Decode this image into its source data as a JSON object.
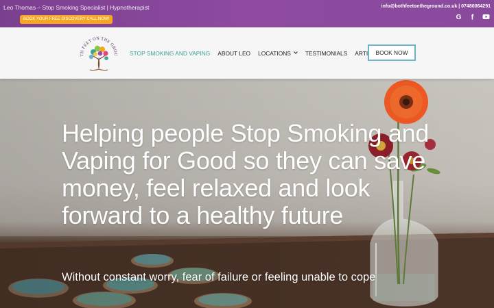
{
  "topbar": {
    "tagline": "Leo Thomas – Stop Smoking Specialist | Hypnotherapist",
    "cta_label": "BOOK YOUR FREE DISCOVERY CALL NOW!",
    "contact": "info@bothfeetontheground.co.uk | 07480064291",
    "social": [
      {
        "icon": "google-icon",
        "glyph": "G"
      },
      {
        "icon": "facebook-icon",
        "glyph": "f"
      },
      {
        "icon": "youtube-icon",
        "glyph": "▶"
      }
    ]
  },
  "logo": {
    "text": "BOTH FEET ON THE GROUND",
    "icon": "tree-logo-icon"
  },
  "nav": {
    "items": [
      {
        "label": "STOP SMOKING AND VAPING",
        "active": true
      },
      {
        "label": "ABOUT LEO",
        "active": false
      },
      {
        "label": "LOCATIONS",
        "active": false,
        "dropdown": true
      },
      {
        "label": "TESTIMONIALS",
        "active": false
      },
      {
        "label": "ARTICLES",
        "active": false
      }
    ],
    "dropdown_icon": "chevron-down-icon",
    "book_label": "BOOK NOW"
  },
  "hero": {
    "heading": "Helping people Stop Smoking and Vaping for Good so they can save money, feel relaxed and look forward to a healthy future",
    "subheading": "Without constant worry, fear of failure or feeling unable to cope"
  },
  "colors": {
    "topbar_purple": "#8a4a9c",
    "cta_orange": "#f5a623",
    "nav_active": "#3aa394",
    "book_border": "#6ab4c6"
  }
}
